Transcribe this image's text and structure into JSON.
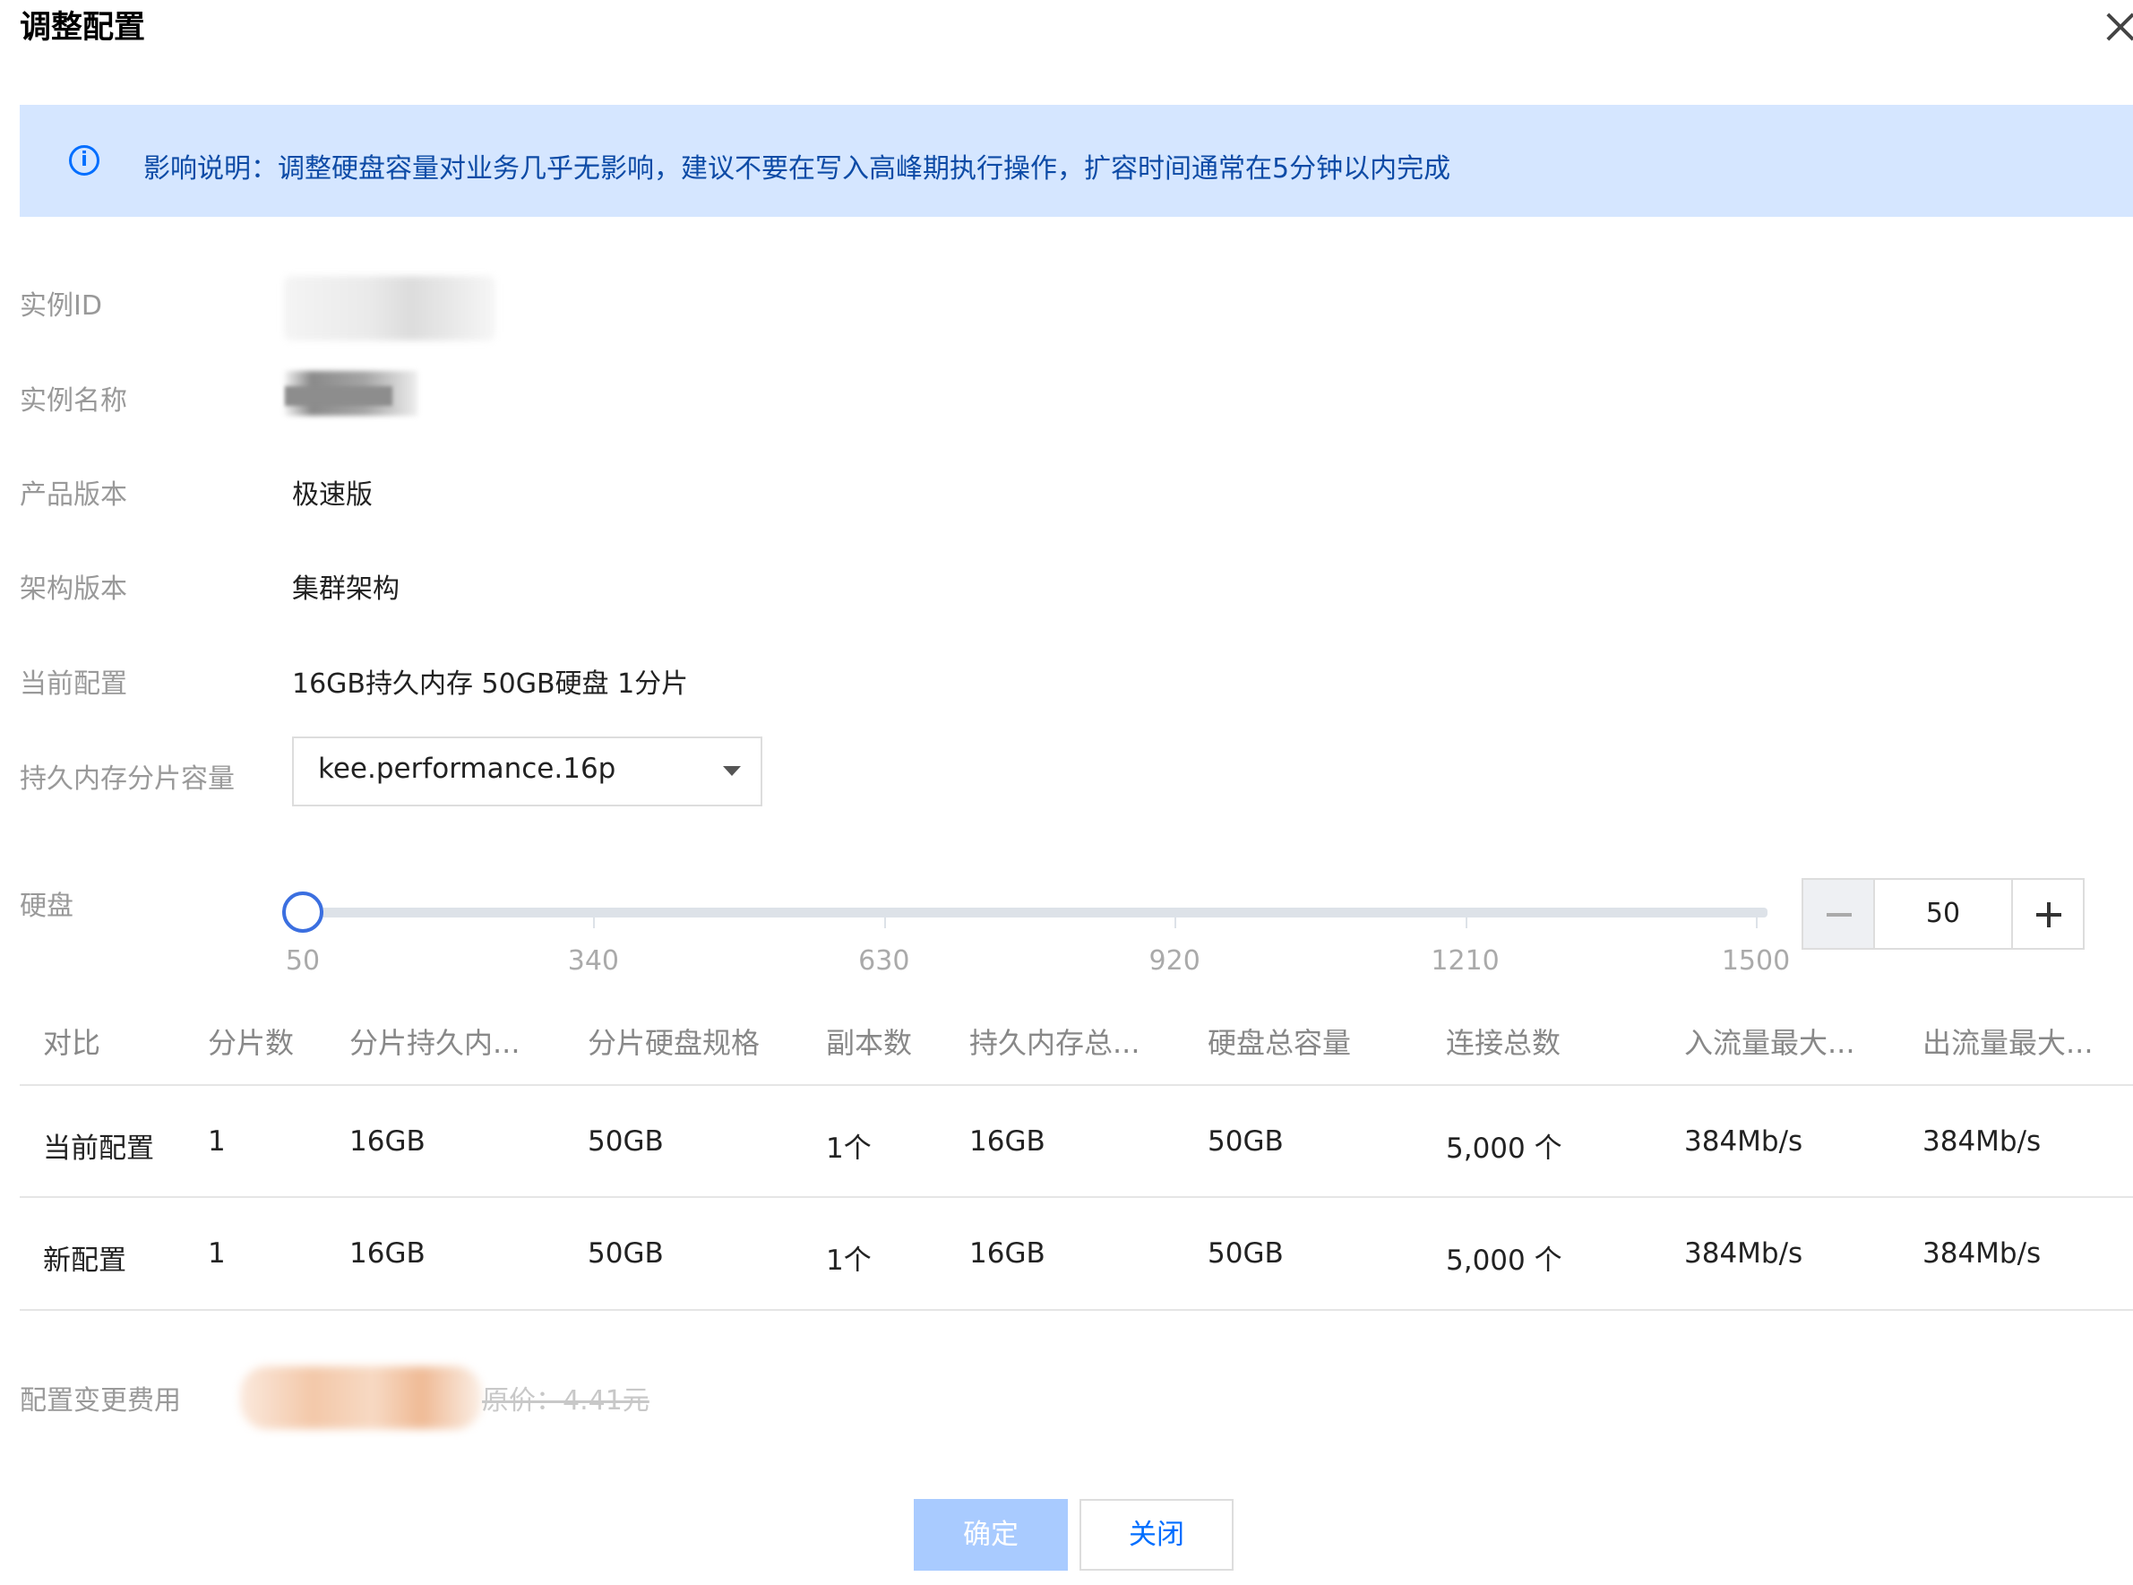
{
  "dialog": {
    "title": "调整配置"
  },
  "notice": {
    "icon": "info-icon",
    "text": "影响说明：调整硬盘容量对业务几乎无影响，建议不要在写入高峰期执行操作，扩容时间通常在5分钟以内完成"
  },
  "fields": {
    "instance_id_label": "实例ID",
    "instance_name_label": "实例名称",
    "product_version_label": "产品版本",
    "product_version_value": "极速版",
    "arch_version_label": "架构版本",
    "arch_version_value": "集群架构",
    "current_config_label": "当前配置",
    "current_config_value": "16GB持久内存 50GB硬盘 1分片",
    "shard_capacity_label": "持久内存分片容量",
    "shard_capacity_value": "kee.performance.16p",
    "disk_label": "硬盘"
  },
  "slider": {
    "min": 50,
    "max": 1500,
    "value": 50,
    "ticks": [
      "50",
      "340",
      "630",
      "920",
      "1210",
      "1500"
    ]
  },
  "stepper": {
    "value": "50"
  },
  "table": {
    "headers": [
      "对比",
      "分片数",
      "分片持久内...",
      "分片硬盘规格",
      "副本数",
      "持久内存总...",
      "硬盘总容量",
      "连接总数",
      "入流量最大...",
      "出流量最大..."
    ],
    "rows": [
      [
        "当前配置",
        "1",
        "16GB",
        "50GB",
        "1个",
        "16GB",
        "50GB",
        "5,000 个",
        "384Mb/s",
        "384Mb/s"
      ],
      [
        "新配置",
        "1",
        "16GB",
        "50GB",
        "1个",
        "16GB",
        "50GB",
        "5,000 个",
        "384Mb/s",
        "384Mb/s"
      ]
    ]
  },
  "fee": {
    "label": "配置变更费用",
    "original_price": "原价：4.41元"
  },
  "buttons": {
    "ok": "确定",
    "close": "关闭"
  },
  "colors": {
    "accent": "#006eff",
    "notice_bg": "#d5e6ff",
    "ok_disabled": "#a9cbff"
  }
}
